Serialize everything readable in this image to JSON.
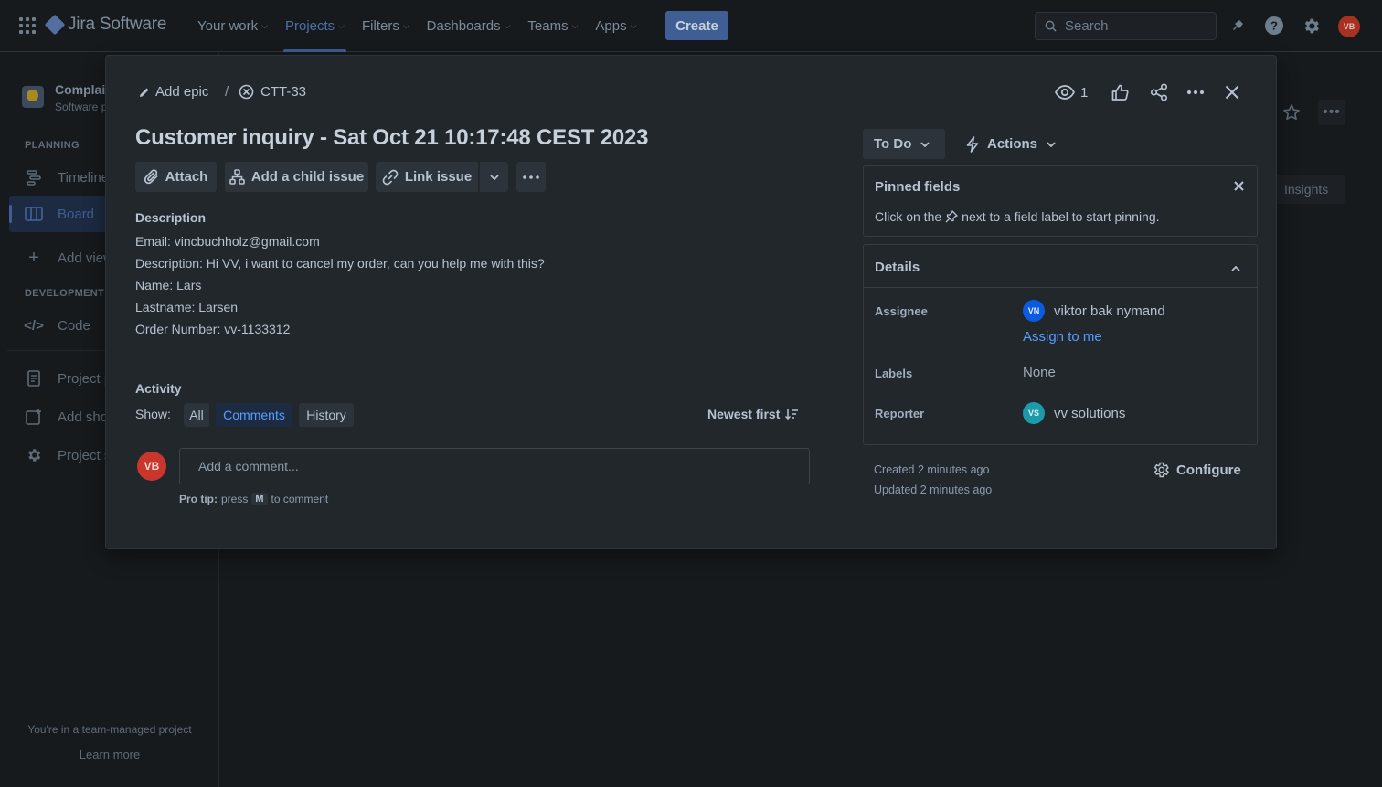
{
  "nav": {
    "logo": "Jira Software",
    "items": [
      {
        "label": "Your work",
        "active": false
      },
      {
        "label": "Projects",
        "active": true
      },
      {
        "label": "Filters",
        "active": false
      },
      {
        "label": "Dashboards",
        "active": false
      },
      {
        "label": "Teams",
        "active": false
      },
      {
        "label": "Apps",
        "active": false
      }
    ],
    "create_label": "Create",
    "search_placeholder": "Search",
    "avatar_initials": "VB"
  },
  "sidebar": {
    "project_name": "Complai",
    "project_type": "Software p",
    "planning_heading": "PLANNING",
    "timeline": "Timeline",
    "board": "Board",
    "add_view": "Add view",
    "development_heading": "DEVELOPMENT",
    "code": "Code",
    "project_pages": "Project p",
    "add_shortcut": "Add sho",
    "project_settings": "Project s",
    "footer_text": "You're in a team-managed project",
    "learn_more": "Learn more"
  },
  "background": {
    "insights": "Insights"
  },
  "issue": {
    "add_epic": "Add epic",
    "separator": "/",
    "key": "CTT-33",
    "watch_count": "1",
    "title": "Customer inquiry - Sat Oct 21 10:17:48 CEST 2023",
    "toolbar": {
      "attach": "Attach",
      "add_child": "Add a child issue",
      "link_issue": "Link issue"
    },
    "description_heading": "Description",
    "description_lines": [
      "Email: vincbuchholz@gmail.com",
      "Description: Hi VV, i want to cancel my order, can you help me with this?",
      "Name: Lars",
      "Lastname: Larsen",
      "Order Number: vv-1133312"
    ],
    "activity_heading": "Activity",
    "show_label": "Show:",
    "filters": [
      {
        "label": "All",
        "selected": false
      },
      {
        "label": "Comments",
        "selected": true
      },
      {
        "label": "History",
        "selected": false
      }
    ],
    "sort_label": "Newest first",
    "comment_avatar": "VB",
    "comment_placeholder": "Add a comment...",
    "protip_prefix": "Pro tip:",
    "protip_press": "press",
    "protip_key": "M",
    "protip_suffix": "to comment"
  },
  "right_panel": {
    "status": "To Do",
    "actions": "Actions",
    "pinned_title": "Pinned fields",
    "pinned_text_before": "Click on the",
    "pinned_text_after": "next to a field label to start pinning.",
    "details_title": "Details",
    "assignee_label": "Assignee",
    "assignee_initials": "VN",
    "assignee_name": "viktor bak nymand",
    "assign_to_me": "Assign to me",
    "labels_label": "Labels",
    "labels_value": "None",
    "reporter_label": "Reporter",
    "reporter_initials": "VS",
    "reporter_name": "vv solutions",
    "created": "Created 2 minutes ago",
    "updated": "Updated 2 minutes ago",
    "configure": "Configure"
  },
  "colors": {
    "accent": "#579dff",
    "background": "#161a1d",
    "modal": "#22272b"
  }
}
